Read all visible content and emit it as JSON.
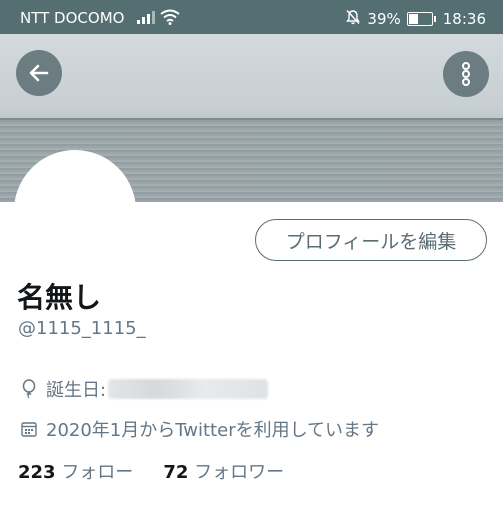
{
  "status_bar": {
    "carrier": "NTT DOCOMO",
    "battery_percent": "39%",
    "battery_level": 0.39,
    "time": "18:36",
    "background_color": "#546e72",
    "icons": [
      "signal-icon",
      "wifi-icon",
      "mute-icon",
      "battery-icon"
    ]
  },
  "header": {
    "back_icon": "arrow-left-icon",
    "more_icon": "more-vertical-icon"
  },
  "profile": {
    "edit_button_label": "プロフィールを編集",
    "display_name": "名無し",
    "handle": "@1115_1115_",
    "birthday_label": "誕生日:",
    "joined_text": "2020年1月からTwitterを利用しています",
    "following_count": "223",
    "following_label": "フォロー",
    "followers_count": "72",
    "followers_label": "フォロワー"
  }
}
